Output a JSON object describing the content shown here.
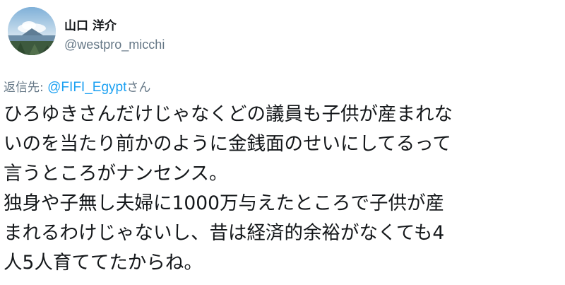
{
  "tweet": {
    "author": {
      "display_name": "山口 洋介",
      "handle": "@westpro_micchi",
      "avatar_icon": "profile-photo-landscape"
    },
    "reply": {
      "prefix": "返信先: ",
      "to_handle": "@FIFI_Egypt",
      "suffix": "さん"
    },
    "body_lines": [
      "ひろゆきさんだけじゃなくどの議員も子供が産まれな",
      "いのを当たり前かのように金銭面のせいにしてるって",
      "言うところがナンセンス。",
      "独身や子無し夫婦に1000万与えたところで子供が産",
      "まれるわけじゃないし、昔は経済的余裕がなくても4",
      "人5人育ててたからね。"
    ]
  },
  "colors": {
    "text": "#14171a",
    "secondary": "#657786",
    "link": "#1da1f2",
    "background": "#ffffff"
  }
}
